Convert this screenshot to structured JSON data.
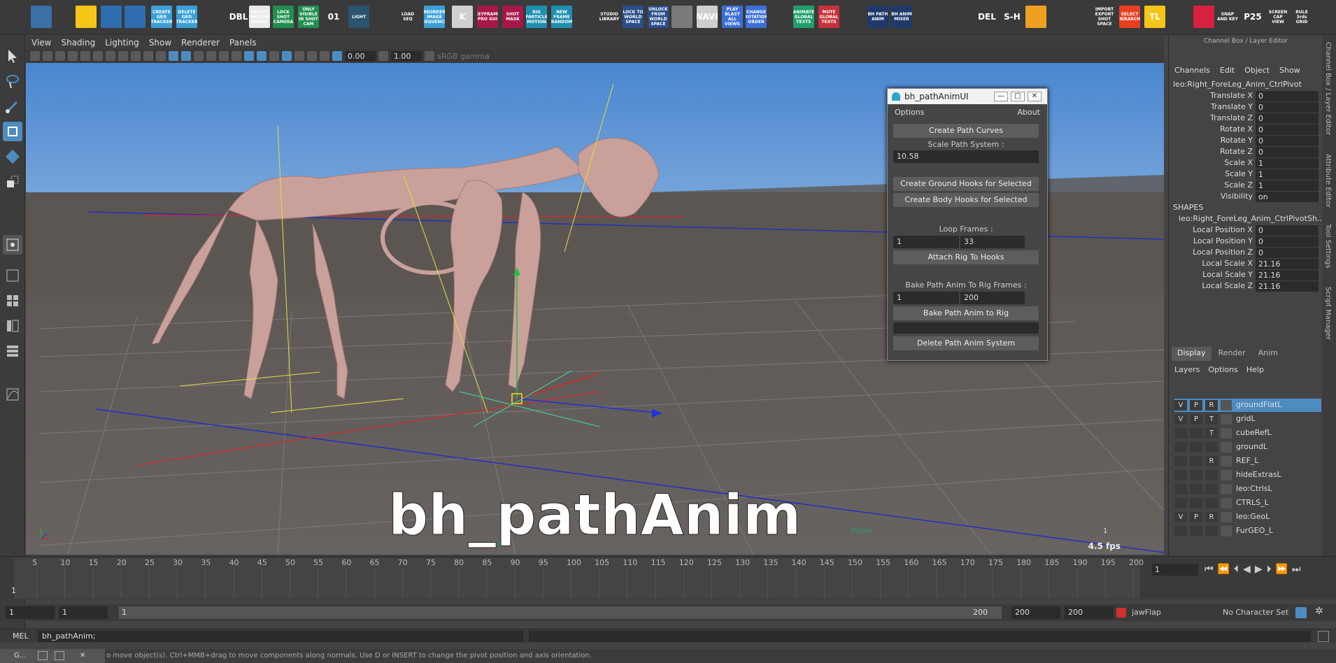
{
  "shelf": {
    "items": [
      {
        "label": "",
        "color": "#3a6fa8"
      },
      {
        "label": "",
        "color": "#f5c518"
      },
      {
        "label": "",
        "color": "#2d6db0"
      },
      {
        "label": "",
        "color": "#2d6db0"
      },
      {
        "label": "CREATE GEO TRACKER",
        "color": "#3aa0d8"
      },
      {
        "label": "DELETE GEO TRACKER",
        "color": "#3aa0d8"
      },
      {
        "label": "DBL",
        "color": "#3a3a3a"
      },
      {
        "label": "DELETE UNKNOWN NODES",
        "color": "#e8e8e8"
      },
      {
        "label": "LOCK SHOT CAMERA",
        "color": "#1f8f4e"
      },
      {
        "label": "ONLY VISIBLE IN SHOT CAM",
        "color": "#1f8f4e"
      },
      {
        "label": "01",
        "color": "#3a3a3a"
      },
      {
        "label": "LIGHT",
        "color": "#2b5470"
      },
      {
        "label": "LOAD SEQ",
        "color": "#3a3a3a"
      },
      {
        "label": "REORDER IMAGE SEQUENCE",
        "color": "#3aa0d8"
      },
      {
        "label": "K",
        "color": "#d0d0d0"
      },
      {
        "label": "KEYFRAME PRO GUI",
        "color": "#a8174a"
      },
      {
        "label": "SHOT MASK",
        "color": "#a8174a"
      },
      {
        "label": "RIG PARTICLE MOTION",
        "color": "#1f8fb0"
      },
      {
        "label": "NEW FRAME RANDOM",
        "color": "#1f8fb0"
      },
      {
        "label": "STUDIO LIBRARY",
        "color": "#3a3a3a"
      },
      {
        "label": "LOCK TO WORLD SPACE",
        "color": "#2a4e8a"
      },
      {
        "label": "UNLOCK FROM WORLD SPACE",
        "color": "#2a4e8a"
      },
      {
        "label": "",
        "color": "#7a7a7a"
      },
      {
        "label": "WAVE",
        "color": "#cfcfcf"
      },
      {
        "label": "PLAY BLAST ALL VIEWS",
        "color": "#3a6fd8"
      },
      {
        "label": "CHANGE ROTATION ORDER",
        "color": "#3a6fd8"
      },
      {
        "label": "ANIMATE GLOBAL TEXTS",
        "color": "#1f9f6a"
      },
      {
        "label": "MUTE GLOBAL TEXTS",
        "color": "#c8303a"
      },
      {
        "label": "BH PATH ANIM",
        "color": "#1f3a6a"
      },
      {
        "label": "BH ANIM MIXER",
        "color": "#1f3a6a"
      },
      {
        "label": "",
        "color": "#3a3a3a"
      },
      {
        "label": "",
        "color": "#3a3a3a"
      },
      {
        "label": "DEL",
        "color": "#3a3a3a"
      },
      {
        "label": "S-H",
        "color": "#3a3a3a"
      },
      {
        "label": "",
        "color": "#f0a020"
      },
      {
        "label": "",
        "color": "#3a3a3a"
      },
      {
        "label": "IMPORT EXPORT SHOT SPACE",
        "color": "#3a3a3a"
      },
      {
        "label": "SELECT HIERARCHY",
        "color": "#e84020"
      },
      {
        "label": "TL",
        "color": "#f5c518"
      },
      {
        "label": "",
        "color": "#3a3a3a"
      },
      {
        "label": "",
        "color": "#d82040"
      },
      {
        "label": "SNAP AND KEY",
        "color": "#3a3a3a"
      },
      {
        "label": "P25",
        "color": "#3a3a3a"
      },
      {
        "label": "SCREEN CAP VIEW",
        "color": "#3a3a3a"
      },
      {
        "label": "RULE 3rds GRID",
        "color": "#3a3a3a"
      }
    ]
  },
  "viewport": {
    "menu": [
      "View",
      "Shading",
      "Lighting",
      "Show",
      "Renderer",
      "Panels"
    ],
    "exposure": "0.00",
    "gamma": "1.00",
    "colorspace": "sRGB gamma",
    "camera_label": "persp",
    "frame_label": "Frame",
    "frame_value": "1",
    "fps": "4.5 fps",
    "overlay_title": "bh_pathAnim"
  },
  "pathwin": {
    "title": "bh_pathAnimUI",
    "menu_options": "Options",
    "menu_about": "About",
    "create_path_curves": "Create Path Curves",
    "scale_label": "Scale Path System :",
    "scale_value": "10.58",
    "ground_hooks": "Create Ground Hooks for Selected",
    "body_hooks": "Create Body Hooks for Selected",
    "loop_label": "Loop Frames :",
    "loop_start": "1",
    "loop_end": "33",
    "attach": "Attach Rig To Hooks",
    "bake_label": "Bake Path Anim To Rig Frames :",
    "bake_start": "1",
    "bake_end": "200",
    "bake_btn": "Bake Path Anim to Rig",
    "delete_btn": "Delete Path Anim System"
  },
  "channelbox": {
    "header": "Channel Box / Layer Editor",
    "menu": [
      "Channels",
      "Edit",
      "Object",
      "Show"
    ],
    "node": "leo:Right_ForeLeg_Anim_CtrlPivot",
    "attrs": [
      {
        "name": "Translate X",
        "value": "0"
      },
      {
        "name": "Translate Y",
        "value": "0"
      },
      {
        "name": "Translate Z",
        "value": "0"
      },
      {
        "name": "Rotate X",
        "value": "0"
      },
      {
        "name": "Rotate Y",
        "value": "0"
      },
      {
        "name": "Rotate Z",
        "value": "0"
      },
      {
        "name": "Scale X",
        "value": "1"
      },
      {
        "name": "Scale Y",
        "value": "1"
      },
      {
        "name": "Scale Z",
        "value": "1"
      },
      {
        "name": "Visibility",
        "value": "on"
      }
    ],
    "shapes_header": "SHAPES",
    "shape_node": "leo:Right_ForeLeg_Anim_CtrlPivotSh...",
    "shape_attrs": [
      {
        "name": "Local Position X",
        "value": "0"
      },
      {
        "name": "Local Position Y",
        "value": "0"
      },
      {
        "name": "Local Position Z",
        "value": "0"
      },
      {
        "name": "Local Scale X",
        "value": "21.16"
      },
      {
        "name": "Local Scale Y",
        "value": "21.16"
      },
      {
        "name": "Local Scale Z",
        "value": "21.16"
      }
    ]
  },
  "layers": {
    "tabs": [
      "Display",
      "Render",
      "Anim"
    ],
    "menu": [
      "Layers",
      "Options",
      "Help"
    ],
    "rows": [
      {
        "v": "V",
        "p": "P",
        "r": "R",
        "name": "groundFlatL"
      },
      {
        "v": "V",
        "p": "P",
        "r": "T",
        "name": "gridL"
      },
      {
        "v": "",
        "p": "",
        "r": "T",
        "name": "cubeRefL"
      },
      {
        "v": "",
        "p": "",
        "r": "",
        "name": "groundL"
      },
      {
        "v": "",
        "p": "",
        "r": "R",
        "name": "REF_L"
      },
      {
        "v": "",
        "p": "",
        "r": "",
        "name": "hideExtrasL"
      },
      {
        "v": "",
        "p": "",
        "r": "",
        "name": "leo:CtrlsL"
      },
      {
        "v": "",
        "p": "",
        "r": "",
        "name": "CTRLS_L"
      },
      {
        "v": "V",
        "p": "P",
        "r": "R",
        "name": "leo:GeoL"
      },
      {
        "v": "",
        "p": "",
        "r": "",
        "name": "FurGEO_L"
      }
    ]
  },
  "side_tabs": [
    "Channel Box / Layer Editor",
    "Attribute Editor",
    "Tool Settings",
    "Script Manager"
  ],
  "timeline": {
    "ticks": [
      "5",
      "10",
      "15",
      "20",
      "25",
      "30",
      "35",
      "40",
      "45",
      "50",
      "55",
      "60",
      "65",
      "70",
      "75",
      "80",
      "85",
      "90",
      "95",
      "100",
      "105",
      "110",
      "115",
      "120",
      "125",
      "130",
      "135",
      "140",
      "145",
      "150",
      "155",
      "160",
      "165",
      "170",
      "175",
      "180",
      "185",
      "190",
      "195",
      "200"
    ],
    "current_frame": "1",
    "current_field": "1"
  },
  "range": {
    "start": "1",
    "anim_start": "1",
    "range_left": "1",
    "range_right": "200",
    "end": "200",
    "anim_end": "200",
    "anim_layer": "jawFlap",
    "character_set": "No Character Set"
  },
  "cmd": {
    "mode": "MEL",
    "text": "bh_pathAnim;"
  },
  "help": {
    "text": "o move object(s). Ctrl+MMB+drag to move components along normals. Use D or INSERT to change the pivot position and axis orientation.",
    "task": "G..."
  }
}
